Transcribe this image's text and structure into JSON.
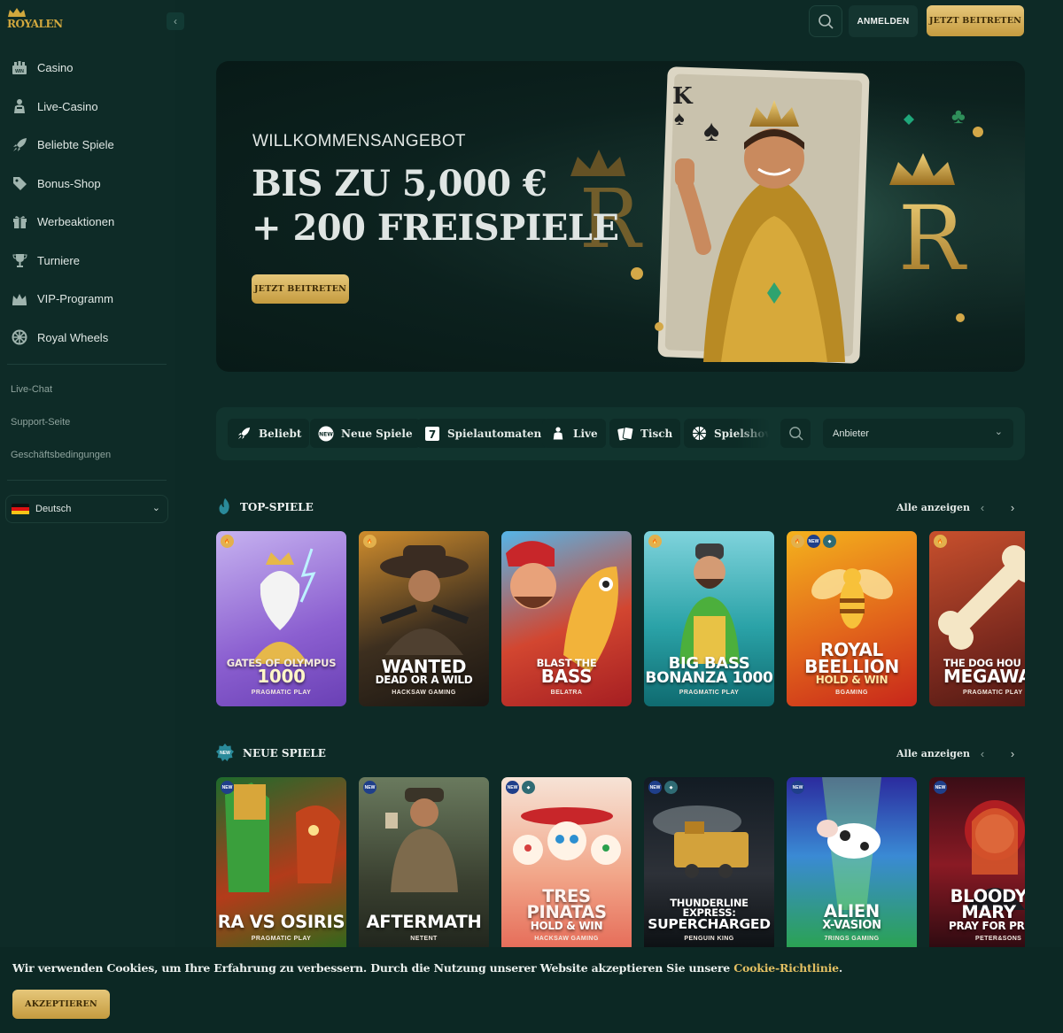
{
  "brand": {
    "logo_text": "ROYALEN"
  },
  "sidebar": {
    "items": [
      {
        "label": "Casino",
        "icon": "casino-icon"
      },
      {
        "label": "Live-Casino",
        "icon": "dealer-icon"
      },
      {
        "label": "Beliebte Spiele",
        "icon": "rocket-icon"
      },
      {
        "label": "Bonus-Shop",
        "icon": "tag-icon"
      },
      {
        "label": "Werbeaktionen",
        "icon": "gift-icon"
      },
      {
        "label": "Turniere",
        "icon": "trophy-icon"
      },
      {
        "label": "VIP-Programm",
        "icon": "crown-icon"
      },
      {
        "label": "Royal Wheels",
        "icon": "wheel-icon"
      }
    ],
    "links": [
      "Live-Chat",
      "Support-Seite",
      "Geschäftsbedingungen"
    ],
    "language": "Deutsch"
  },
  "header": {
    "login": "ANMELDEN",
    "join": "JETZT BEITRETEN"
  },
  "hero": {
    "kicker": "WILLKOMMENSANGEBOT",
    "line1": "BIS ZU 5,000 €",
    "line2": "+ 200 FREISPIELE",
    "cta": "JETZT BEITRETEN"
  },
  "filters": {
    "chips": [
      {
        "label": "Beliebt",
        "icon": "rocket-icon"
      },
      {
        "label": "Neue Spiele",
        "icon": "new-badge-icon"
      },
      {
        "label": "Spielautomaten",
        "icon": "slot-seven-icon"
      },
      {
        "label": "Live",
        "icon": "dealer-icon"
      },
      {
        "label": "Tisch",
        "icon": "cards-icon"
      },
      {
        "label": "Spielshow",
        "icon": "wheel-icon"
      }
    ],
    "provider_placeholder": "Anbieter"
  },
  "sections": {
    "top": {
      "title": "TOP-SPIELE",
      "see_all": "Alle anzeigen",
      "games": [
        {
          "small": "GATES OF OLYMPUS",
          "title": "1000",
          "provider": "PRAGMATIC PLAY",
          "badges": [
            "fire"
          ]
        },
        {
          "small": "",
          "title": "WANTED",
          "sub": "DEAD OR A WILD",
          "provider": "HACKSAW GAMING",
          "badges": [
            "fire"
          ]
        },
        {
          "small": "BLAST THE",
          "title": "BASS",
          "provider": "BELATRA",
          "badges": []
        },
        {
          "small": "",
          "title": "BIG BASS",
          "sub": "BONANZA 1000",
          "provider": "PRAGMATIC PLAY",
          "badges": [
            "fire"
          ]
        },
        {
          "small": "",
          "title": "ROYAL BEELLION",
          "sub": "HOLD & WIN",
          "provider": "BGAMING",
          "badges": [
            "fire",
            "NEW",
            "drop"
          ]
        },
        {
          "small": "THE DOG HOU",
          "title": "MEGAWAY",
          "provider": "PRAGMATIC PLAY",
          "badges": [
            "fire"
          ]
        }
      ]
    },
    "new": {
      "title": "NEUE SPIELE",
      "see_all": "Alle anzeigen",
      "games": [
        {
          "title": "RA VS OSIRIS",
          "provider": "PRAGMATIC PLAY",
          "badges": [
            "NEW"
          ]
        },
        {
          "title": "AFTERMATH",
          "provider": "NETENT",
          "badges": [
            "NEW"
          ]
        },
        {
          "title": "TRES PINATAS",
          "sub": "HOLD & WIN",
          "provider": "HACKSAW GAMING",
          "badges": [
            "NEW",
            "drop"
          ]
        },
        {
          "small": "THUNDERLINE EXPRESS:",
          "title": "SUPERCHARGED",
          "provider": "PENGUIN KING",
          "badges": [
            "NEW",
            "drop"
          ]
        },
        {
          "title": "ALIEN",
          "sub": "X-VASION",
          "provider": "7RINGS GAMING",
          "badges": [
            "NEW"
          ]
        },
        {
          "title": "BLOODY MARY",
          "sub": "PRAY FOR PRI",
          "provider": "PETER&SONS",
          "badges": [
            "NEW"
          ]
        }
      ]
    }
  },
  "cookie": {
    "text": "Wir verwenden Cookies, um Ihre Erfahrung zu verbessern. Durch die Nutzung unserer Website akzeptieren Sie unsere ",
    "link": "Cookie-Richtlinie",
    "end": ".",
    "accept": "AKZEPTIEREN"
  },
  "colors": {
    "bg": "#0d2a26",
    "gold": "#d8b35a",
    "panel": "#11342e"
  }
}
